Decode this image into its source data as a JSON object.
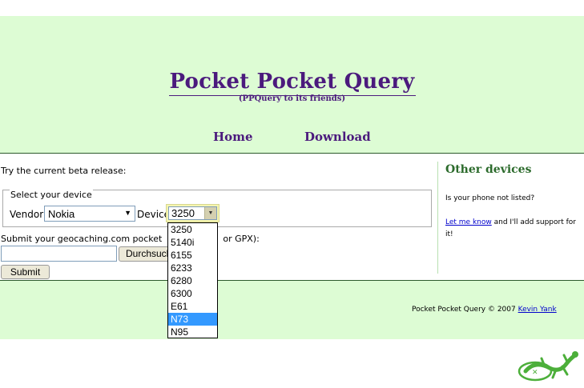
{
  "header": {
    "title": "Pocket Pocket Query",
    "subtitle": "(PPQuery to its friends)",
    "nav": [
      "Home",
      "Download"
    ]
  },
  "main": {
    "beta_text": "Try the current beta release:",
    "fieldset_legend": "Select your device",
    "vendor_label": "Vendor",
    "vendor_value": "Nokia",
    "device_label": "Device",
    "device_value": "3250",
    "device_options": [
      "3250",
      "5140i",
      "6155",
      "6233",
      "6280",
      "6300",
      "E61",
      "N73",
      "N95"
    ],
    "highlighted_option": "N73",
    "submit_text_start": "Submit your geocaching.com pocket",
    "submit_text_end": "or GPX):",
    "browse_label": "Durchsuchen...",
    "submit_button": "Submit"
  },
  "aside": {
    "title": "Other devices",
    "question": "Is your phone not listed?",
    "link_text": "Let me know",
    "rest_text": " and I'll add support for it!"
  },
  "footer": {
    "text": "Pocket Pocket Query © 2007 ",
    "author": "Kevin Yank"
  },
  "colors": {
    "header_bg": "#ddfcd4",
    "title_purple": "#4b1a7d",
    "aside_green": "#2c6b2c",
    "selected_blue": "#3399ff",
    "link_blue": "#0000cc"
  }
}
